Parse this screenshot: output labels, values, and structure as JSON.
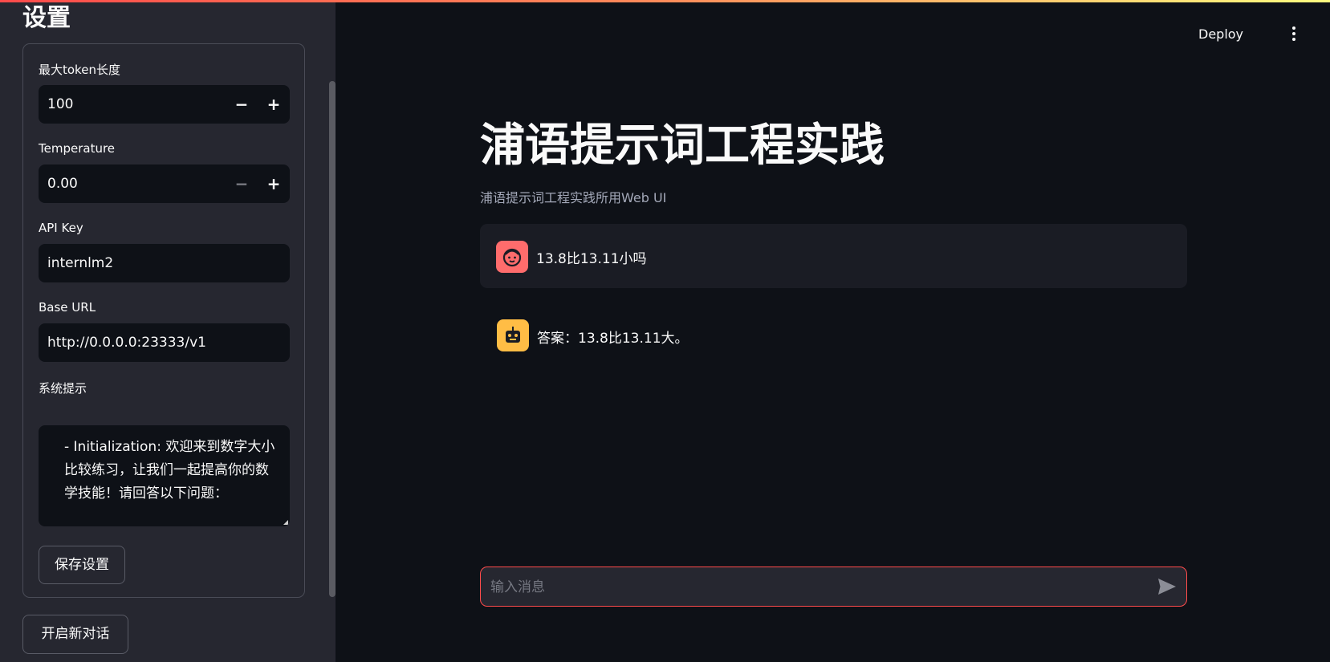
{
  "sidebar": {
    "title": "设置",
    "max_tokens": {
      "label": "最大token长度",
      "value": "100"
    },
    "temperature": {
      "label": "Temperature",
      "value": "0.00"
    },
    "api_key": {
      "label": "API Key",
      "value": "internlm2"
    },
    "base_url": {
      "label": "Base URL",
      "value": "http://0.0.0.0:23333/v1"
    },
    "system_prompt": {
      "label": "系统提示",
      "value": "- Initialization: 欢迎来到数字大小比较练习，让我们一起提高你的数学技能！请回答以下问题："
    },
    "save_label": "保存设置",
    "new_chat_label": "开启新对话",
    "stepper": {
      "minus": "−",
      "plus": "+"
    }
  },
  "header": {
    "deploy_label": "Deploy"
  },
  "main": {
    "title": "浦语提示词工程实践",
    "subtitle": "浦语提示词工程实践所用Web UI",
    "messages": [
      {
        "role": "user",
        "text": "13.8比13.11小吗"
      },
      {
        "role": "assistant",
        "text": "答案：13.8比13.11大。"
      }
    ],
    "chat_input_placeholder": "输入消息"
  },
  "colors": {
    "accent": "#ff4b4b",
    "user_avatar": "#ff6c6c",
    "bot_avatar": "#ffbd45",
    "background": "#0e1117",
    "sidebar_bg": "#262730"
  },
  "icons": [
    "user-face-icon",
    "robot-icon",
    "send-icon",
    "more-vert-icon"
  ]
}
